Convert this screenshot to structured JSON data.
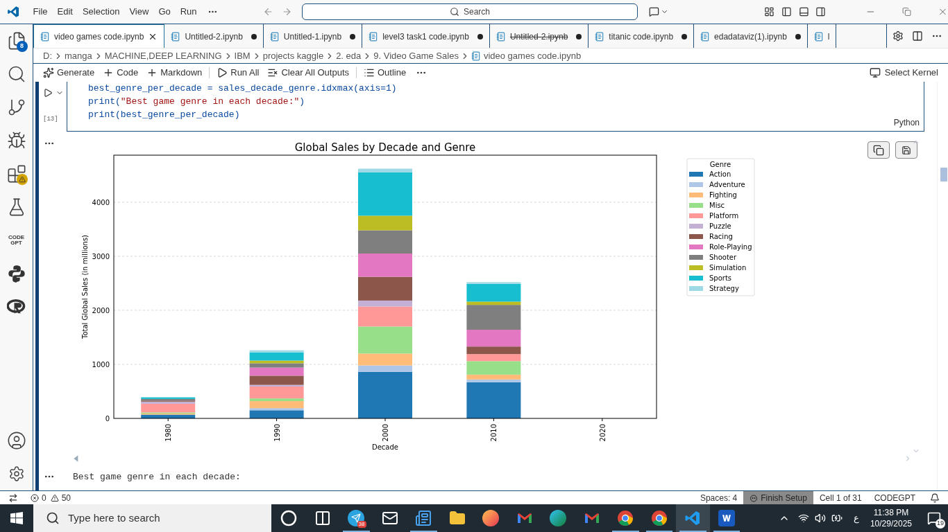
{
  "menu_bar": {
    "items": [
      "File",
      "Edit",
      "Selection",
      "View",
      "Go",
      "Run"
    ]
  },
  "search": {
    "placeholder": "Search"
  },
  "activity_bar": {
    "items": [
      {
        "kind": "explorer",
        "badge": "8"
      },
      {
        "kind": "search"
      },
      {
        "kind": "source-control"
      },
      {
        "kind": "run-debug"
      },
      {
        "kind": "extensions",
        "warning": true
      },
      {
        "kind": "testing"
      },
      {
        "kind": "codegpt",
        "label": "CODE GPT"
      },
      {
        "kind": "python"
      },
      {
        "kind": "r"
      }
    ]
  },
  "tabs": [
    {
      "label": "video games code.ipynb",
      "selected": true,
      "dirty": false,
      "deleted": false
    },
    {
      "label": "Untitled-2.ipynb",
      "selected": false,
      "dirty": true,
      "deleted": false
    },
    {
      "label": "Untitled-1.ipynb",
      "selected": false,
      "dirty": true,
      "deleted": false
    },
    {
      "label": "level3 task1 code.ipynb",
      "selected": false,
      "dirty": true,
      "deleted": false
    },
    {
      "label": "Untitled-2.ipynb",
      "selected": false,
      "dirty": true,
      "deleted": true
    },
    {
      "label": "titanic code.ipynb",
      "selected": false,
      "dirty": true,
      "deleted": false
    },
    {
      "label": "edadataviz(1).ipynb",
      "selected": false,
      "dirty": true,
      "deleted": false
    },
    {
      "label": "l",
      "selected": false,
      "dirty": false,
      "deleted": false
    }
  ],
  "breadcrumb": [
    "D:",
    "manga",
    "MACHINE,DEEP LEARNING",
    "IBM",
    "projects kaggle",
    "2. eda",
    "9. Video Game Sales",
    "video games code.ipynb"
  ],
  "toolbar": {
    "items": [
      {
        "kind": "generate",
        "label": "Generate"
      },
      {
        "kind": "add",
        "label": "Code"
      },
      {
        "kind": "add",
        "label": "Markdown"
      },
      {
        "kind": "run",
        "label": "Run All"
      },
      {
        "kind": "clear",
        "label": "Clear All Outputs"
      },
      {
        "kind": "outline",
        "label": "Outline"
      }
    ],
    "kernel": "Select Kernel"
  },
  "code_cell": {
    "lines": [
      "best_genre_per_decade = sales_decade_genre.idxmax(axis=1)",
      "print(\"Best game genre in each decade:\")",
      "print(best_genre_per_decade)"
    ],
    "execution_count": "[13]",
    "language": "Python"
  },
  "output": {
    "text": "Best game genre in each decade:",
    "chart_data": {
      "type": "bar",
      "title": "Global Sales by Decade and Genre",
      "xlabel": "Decade",
      "ylabel": "Total Global Sales (in millions)",
      "stacked": true,
      "grid": true,
      "legend": {
        "title": "Genre"
      },
      "categories": [
        "1980",
        "1990",
        "2000",
        "2010",
        "2020"
      ],
      "ylim": [
        0,
        4870
      ],
      "yticks": [
        0,
        1000,
        2000,
        3000,
        4000
      ],
      "series": [
        {
          "name": "Action",
          "color": "#1f77b4",
          "values": [
            70,
            150,
            860,
            670,
            0
          ]
        },
        {
          "name": "Adventure",
          "color": "#aec7e8",
          "values": [
            0,
            40,
            120,
            50,
            0
          ]
        },
        {
          "name": "Fighting",
          "color": "#ffbb78",
          "values": [
            20,
            130,
            220,
            90,
            0
          ]
        },
        {
          "name": "Misc",
          "color": "#98df8a",
          "values": [
            20,
            50,
            500,
            250,
            0
          ]
        },
        {
          "name": "Platform",
          "color": "#ff9896",
          "values": [
            160,
            220,
            370,
            130,
            0
          ]
        },
        {
          "name": "Puzzle",
          "color": "#c5b0d5",
          "values": [
            40,
            30,
            110,
            null,
            0
          ]
        },
        {
          "name": "Racing",
          "color": "#8c564b",
          "values": [
            20,
            170,
            440,
            140,
            0
          ]
        },
        {
          "name": "Role-Playing",
          "color": "#e377c2",
          "values": [
            0,
            150,
            430,
            310,
            0
          ]
        },
        {
          "name": "Shooter",
          "color": "#7f7f7f",
          "values": [
            30,
            80,
            430,
            460,
            0
          ]
        },
        {
          "name": "Simulation",
          "color": "#bcbd22",
          "values": [
            0,
            50,
            270,
            60,
            0
          ]
        },
        {
          "name": "Sports",
          "color": "#17becf",
          "values": [
            30,
            150,
            800,
            330,
            0
          ]
        },
        {
          "name": "Strategy",
          "color": "#9edae5",
          "values": [
            0,
            40,
            70,
            30,
            0
          ]
        }
      ]
    }
  },
  "status_bar": {
    "errors": "0",
    "warnings": "50",
    "items": [
      {
        "label": "Spaces: 4",
        "highlighted": false
      },
      {
        "label": "Finish Setup",
        "highlighted": true
      },
      {
        "label": "Cell 1 of 31",
        "highlighted": false
      },
      {
        "label": "CODEGPT",
        "highlighted": false
      }
    ]
  },
  "taskbar": {
    "search_placeholder": "Type here to search",
    "apps": [
      {
        "kind": "cortana",
        "running": false,
        "active": false
      },
      {
        "kind": "taskview",
        "running": false,
        "active": false
      },
      {
        "kind": "telegram",
        "badge": "38",
        "running": true,
        "active": false
      },
      {
        "kind": "mail",
        "running": false,
        "active": false
      },
      {
        "kind": "news",
        "running": true,
        "active": false
      },
      {
        "kind": "folder",
        "running": false,
        "active": false
      },
      {
        "kind": "firefox",
        "running": false,
        "active": false
      },
      {
        "kind": "gmail",
        "running": false,
        "active": false
      },
      {
        "kind": "edge",
        "running": false,
        "active": false
      },
      {
        "kind": "gmail",
        "running": false,
        "active": false
      },
      {
        "kind": "chrome",
        "running": true,
        "active": false
      },
      {
        "kind": "chrome",
        "running": true,
        "active": false
      },
      {
        "kind": "vscode",
        "running": true,
        "active": true
      },
      {
        "kind": "word",
        "running": true,
        "active": false
      }
    ],
    "language": "ع",
    "time": "11:38 PM",
    "date": "10/29/2025",
    "notifications": "19"
  }
}
